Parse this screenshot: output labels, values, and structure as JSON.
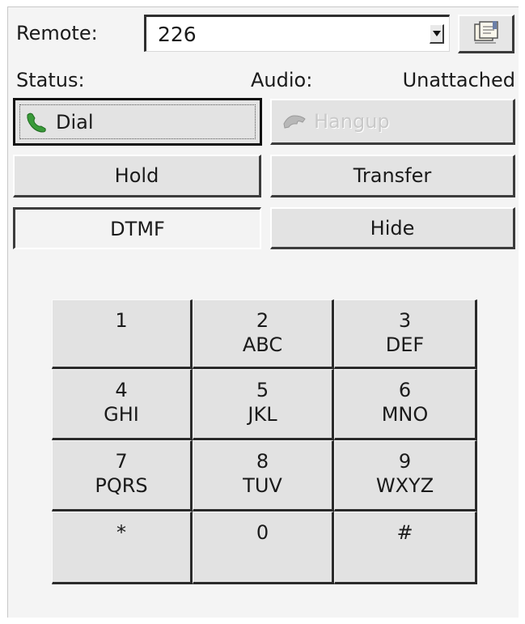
{
  "remote": {
    "label": "Remote:",
    "value": "226"
  },
  "status": {
    "label": "Status:",
    "value": ""
  },
  "audio": {
    "label": "Audio:",
    "value": "Unattached"
  },
  "buttons": {
    "dial": "Dial",
    "hangup": "Hangup",
    "hold": "Hold",
    "transfer": "Transfer",
    "dtmf": "DTMF",
    "hide": "Hide"
  },
  "keypad": [
    {
      "digit": "1",
      "letters": ""
    },
    {
      "digit": "2",
      "letters": "ABC"
    },
    {
      "digit": "3",
      "letters": "DEF"
    },
    {
      "digit": "4",
      "letters": "GHI"
    },
    {
      "digit": "5",
      "letters": "JKL"
    },
    {
      "digit": "6",
      "letters": "MNO"
    },
    {
      "digit": "7",
      "letters": "PQRS"
    },
    {
      "digit": "8",
      "letters": "TUV"
    },
    {
      "digit": "9",
      "letters": "WXYZ"
    },
    {
      "digit": "*",
      "letters": ""
    },
    {
      "digit": "0",
      "letters": ""
    },
    {
      "digit": "#",
      "letters": ""
    }
  ],
  "icons": {
    "dial": "phone-handset-green-icon",
    "hangup": "phone-handset-gray-icon",
    "address_book": "address-book-icon",
    "dropdown": "chevron-down-icon"
  },
  "colors": {
    "dial_icon": "#3a9a3a"
  }
}
